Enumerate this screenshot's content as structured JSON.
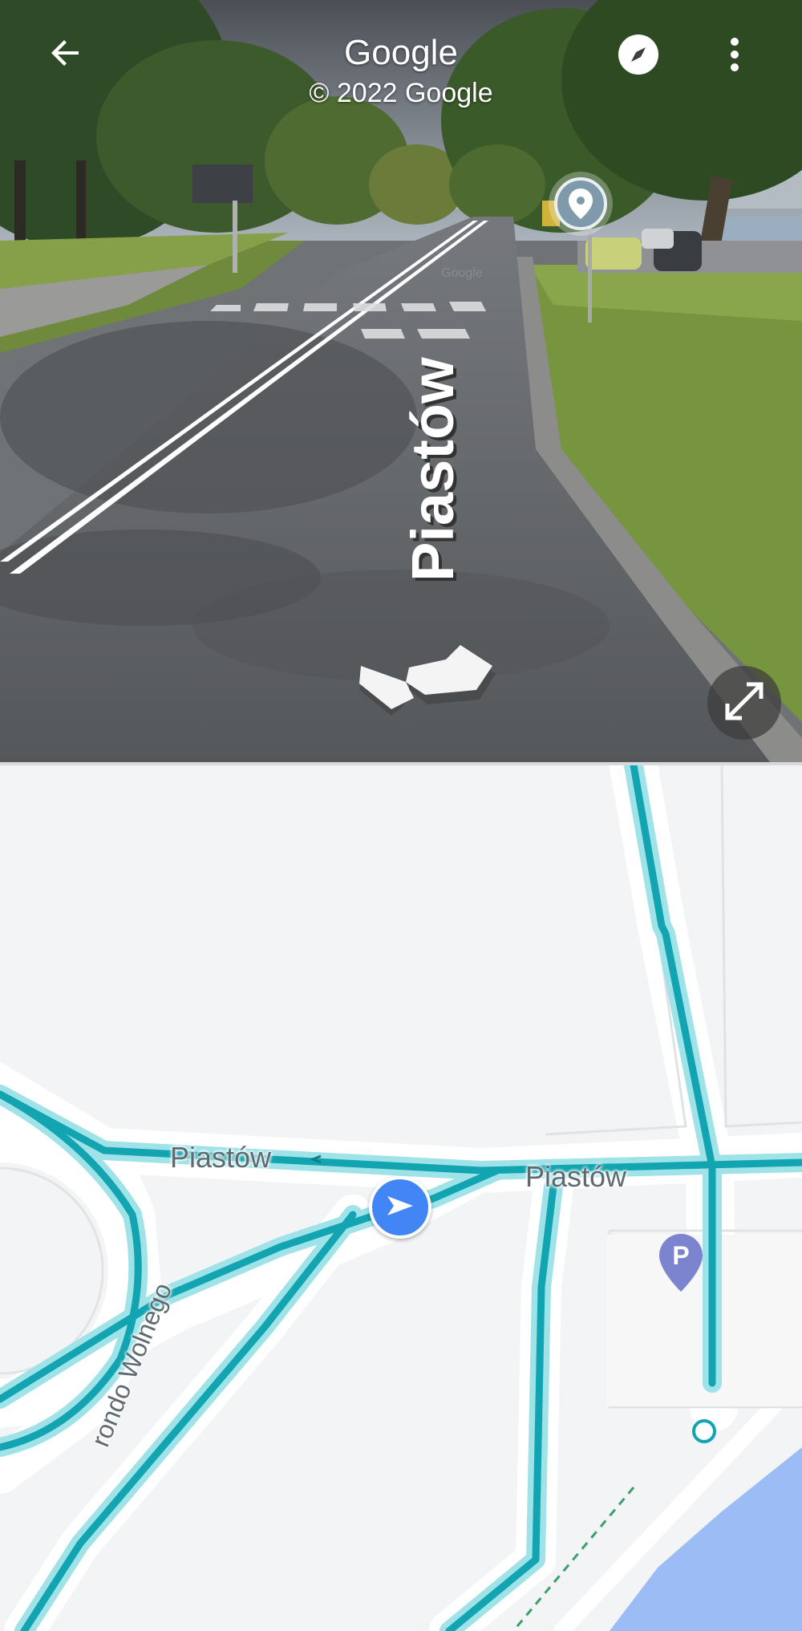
{
  "header": {
    "title": "Google",
    "subtitle": "© 2022 Google"
  },
  "street_view": {
    "street_label": "Piastów",
    "watermark": "Google"
  },
  "map": {
    "labels": {
      "street_1": "Piastów",
      "street_2": "Piastów",
      "roundabout": "rondo Wolnego"
    },
    "parking_label": "P"
  },
  "icons": {
    "back": "arrow-left-icon",
    "compass": "compass-icon",
    "more": "more-vert-icon",
    "expand": "expand-icon",
    "pin": "location-pin-icon",
    "navigation": "navigation-arrow-icon",
    "parking": "parking-pin-icon"
  },
  "colors": {
    "route": "#12a4b0",
    "route_glow": "#9fe3e9",
    "water": "#9bbcf5",
    "nav_blue": "#4285f4",
    "parking_purple": "#7c83cf"
  }
}
